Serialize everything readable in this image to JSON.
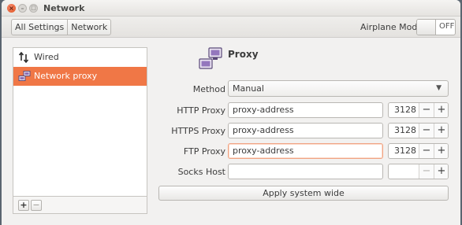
{
  "window": {
    "title": "Network"
  },
  "toolbar": {
    "breadcrumbs": [
      "All Settings",
      "Network"
    ],
    "airplane_label": "Airplane Mode",
    "airplane_state": "OFF"
  },
  "sidebar": {
    "items": [
      {
        "label": "Wired",
        "icon": "wired-network-icon",
        "selected": false
      },
      {
        "label": "Network proxy",
        "icon": "network-proxy-icon",
        "selected": true
      }
    ],
    "add_label": "+",
    "remove_label": "−"
  },
  "proxy": {
    "title": "Proxy",
    "method_label": "Method",
    "method_value": "Manual",
    "rows": [
      {
        "label": "HTTP Proxy",
        "host": "proxy-address",
        "port": "3128"
      },
      {
        "label": "HTTPS Proxy",
        "host": "proxy-address",
        "port": "3128"
      },
      {
        "label": "FTP Proxy",
        "host": "proxy-address",
        "port": "3128"
      },
      {
        "label": "Socks Host",
        "host": "",
        "port": ""
      }
    ],
    "stepper_minus": "−",
    "stepper_plus": "+",
    "apply_label": "Apply system wide"
  },
  "colors": {
    "selection": "#f07746",
    "close_button": "#e0531e"
  }
}
